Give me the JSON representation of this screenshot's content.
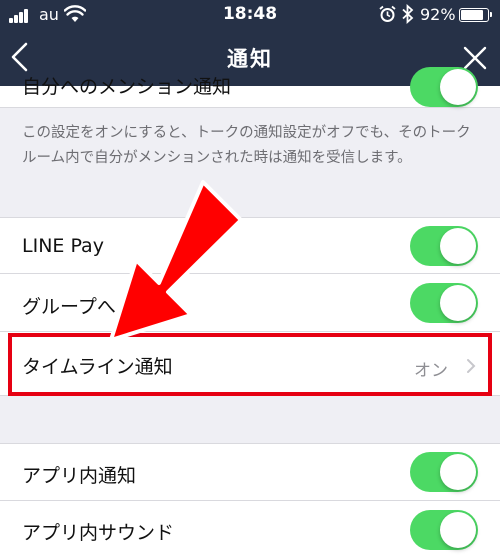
{
  "status_bar": {
    "carrier": "au",
    "time": "18:48",
    "battery": "92%",
    "battery_level": 0.92
  },
  "nav": {
    "title": "通知",
    "back_icon": "chevron-left-icon",
    "close_icon": "close-icon"
  },
  "rows": {
    "mention": {
      "label": "自分へのメンション通知",
      "on": true
    },
    "line_pay": {
      "label": "LINE Pay",
      "on": true
    },
    "group": {
      "label": "グループへ",
      "on": true
    },
    "timeline": {
      "label": "タイムライン通知",
      "value": "オン"
    },
    "in_app": {
      "label": "アプリ内通知",
      "on": true
    },
    "in_app_sound": {
      "label": "アプリ内サウンド",
      "on": true
    }
  },
  "footnote": "この設定をオンにすると、トークの通知設定がオフでも、そのトークルーム内で自分がメンションされた時は通知を受信します。",
  "colors": {
    "header_bg": "#263147",
    "toggle_on": "#4cd964",
    "highlight": "#e60012",
    "arrow": "#ff0000"
  }
}
